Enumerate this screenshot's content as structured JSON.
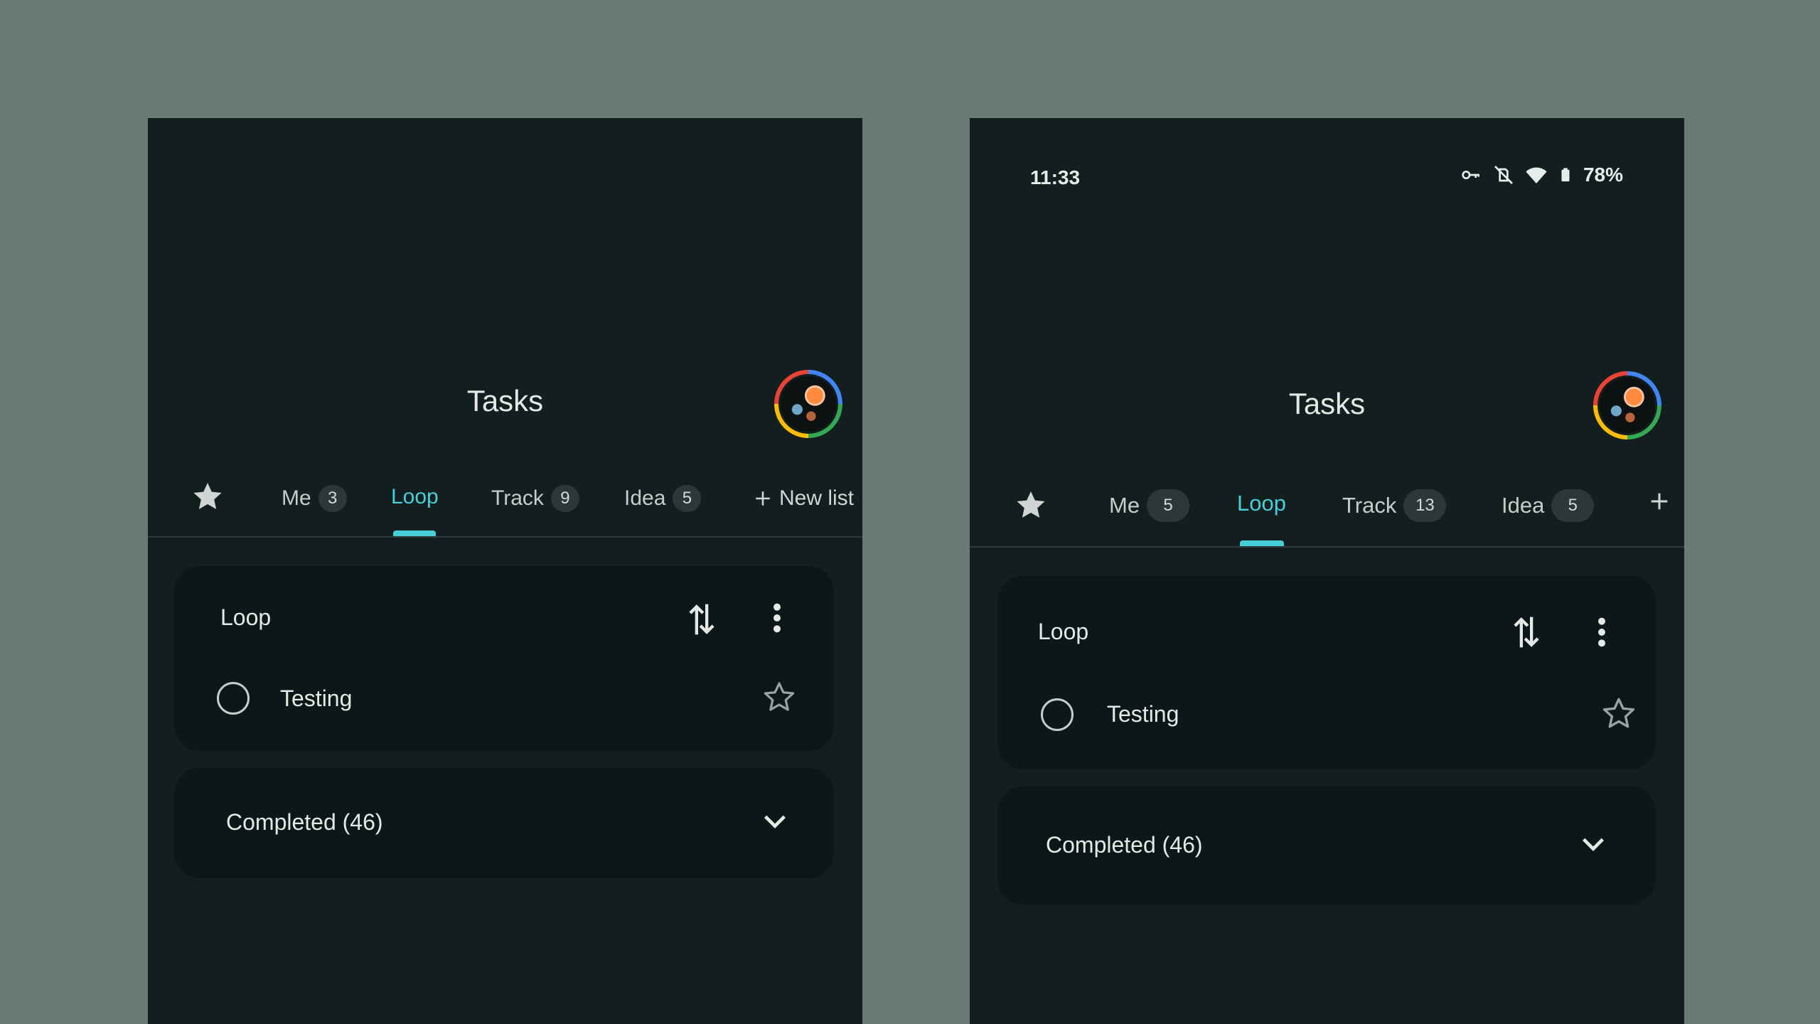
{
  "colors": {
    "background": "#6a7876",
    "surface": "#131f1f",
    "card": "#0c1717",
    "accent": "#47cfd9",
    "text": "#e4e9e7",
    "muted": "#c6ccca"
  },
  "left": {
    "app_title": "Tasks",
    "tabs": [
      {
        "label": "Me",
        "badge": "3"
      },
      {
        "label": "Loop",
        "badge": ""
      },
      {
        "label": "Track",
        "badge": "9"
      },
      {
        "label": "Idea",
        "badge": "5"
      }
    ],
    "active_tab": "Loop",
    "new_list_label": "New list",
    "list": {
      "title": "Loop",
      "tasks": [
        {
          "title": "Testing"
        }
      ]
    },
    "completed_label": "Completed (46)"
  },
  "right": {
    "status": {
      "time": "11:33",
      "battery": "78%"
    },
    "app_title": "Tasks",
    "tabs": [
      {
        "label": "Me",
        "badge": "5"
      },
      {
        "label": "Loop",
        "badge": ""
      },
      {
        "label": "Track",
        "badge": "13"
      },
      {
        "label": "Idea",
        "badge": "5"
      }
    ],
    "active_tab": "Loop",
    "list": {
      "title": "Loop",
      "tasks": [
        {
          "title": "Testing"
        }
      ]
    },
    "completed_label": "Completed (46)"
  },
  "icons": {
    "starred": "star-filled-icon",
    "sort": "sort-arrows-icon",
    "more": "more-vert-icon",
    "star_outline": "star-outline-icon",
    "expand": "chevron-down-icon",
    "add": "plus-icon",
    "vpn": "key-icon",
    "mute": "vibrate-off-icon",
    "wifi": "wifi-icon",
    "battery": "battery-icon"
  }
}
